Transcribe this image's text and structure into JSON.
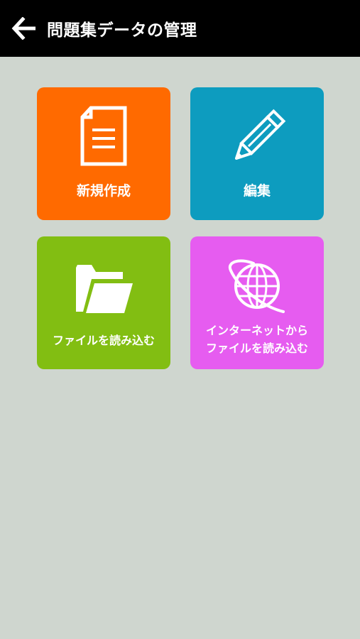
{
  "header": {
    "title": "問題集データの管理",
    "back_icon": "arrow-left-icon"
  },
  "tiles": [
    {
      "label": "新規作成",
      "icon": "document-icon",
      "color": "#ff6a00"
    },
    {
      "label": "編集",
      "icon": "pencil-icon",
      "color": "#0d9cbf"
    },
    {
      "label": "ファイルを読み込む",
      "icon": "folder-icon",
      "color": "#82be12"
    },
    {
      "label_line1": "インターネットから",
      "label_line2": "ファイルを読み込む",
      "icon": "globe-icon",
      "color": "#e65cf0"
    }
  ],
  "colors": {
    "background": "#cfd6cf",
    "appbar": "#000000"
  }
}
